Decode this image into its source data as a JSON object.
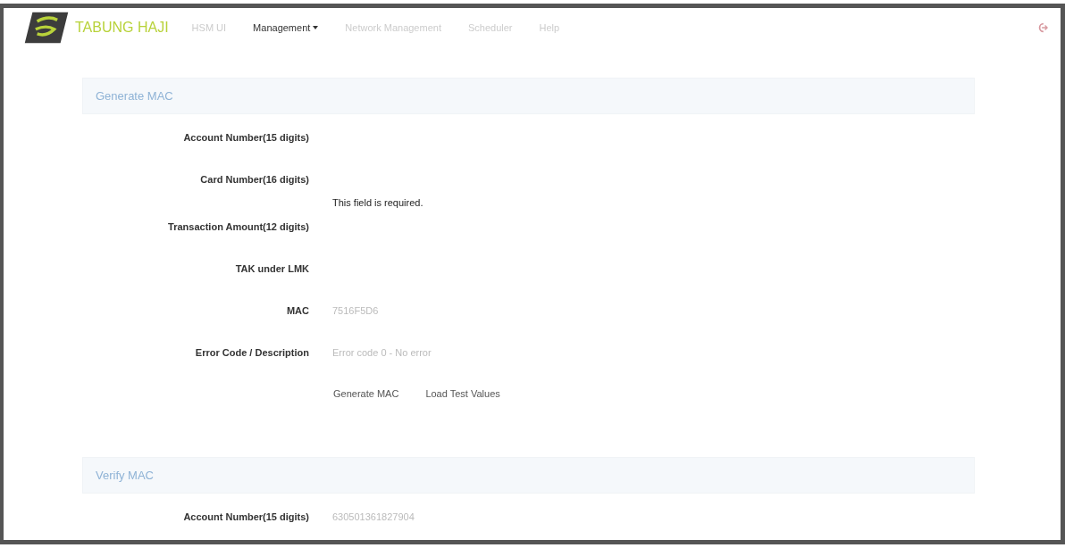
{
  "brand": {
    "name": "TABUNG HAJI"
  },
  "nav": [
    {
      "label": "HSM UI",
      "selected": false,
      "dropdown": false
    },
    {
      "label": "Management",
      "selected": true,
      "dropdown": true
    },
    {
      "label": "Network Management",
      "selected": false,
      "dropdown": false
    },
    {
      "label": "Scheduler",
      "selected": false,
      "dropdown": false
    },
    {
      "label": "Help",
      "selected": false,
      "dropdown": false
    }
  ],
  "panels": [
    {
      "title": "Generate MAC",
      "rows": [
        {
          "label": "Account Number(15 digits)"
        },
        {
          "label": "Card Number(16 digits)",
          "error": "This field is required."
        },
        {
          "label": "Transaction Amount(12 digits)"
        },
        {
          "label": "TAK under LMK"
        },
        {
          "label": "MAC",
          "value": "7516F5D6"
        },
        {
          "label": "Error Code / Description",
          "value": "Error code 0 - No error"
        }
      ],
      "buttons": [
        "Generate MAC",
        "Load Test Values"
      ]
    },
    {
      "title": "Verify MAC",
      "rows": [
        {
          "label": "Account Number(15 digits)",
          "value": "630501361827904"
        }
      ]
    }
  ]
}
